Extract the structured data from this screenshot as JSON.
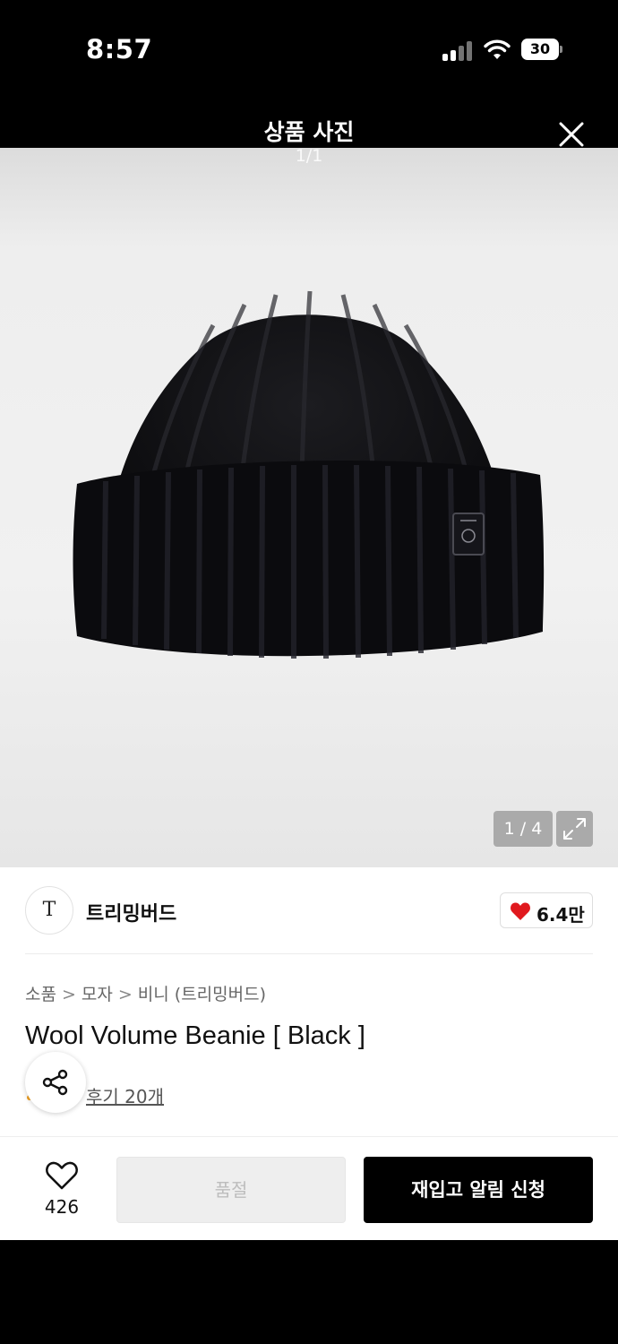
{
  "status_bar": {
    "time": "8:57",
    "battery_level": "30",
    "icons": [
      "cellular-signal-icon",
      "wifi-icon",
      "battery-icon"
    ]
  },
  "viewer": {
    "title": "상품 사진",
    "photo_counter": "1/1",
    "close_icon": "close-icon"
  },
  "gallery": {
    "image_counter": "1 / 4",
    "expand_icon": "expand-icon"
  },
  "brand": {
    "logo_text": "T",
    "name": "트리밍버드",
    "like_count": "6.4만",
    "like_color": "#e0191e"
  },
  "product": {
    "breadcrumb": [
      "소품",
      "모자",
      "비니 (트리밍버드)"
    ],
    "breadcrumb_separator": ">",
    "title": "Wool Volume Beanie [ Black ]",
    "review_link": "후기 20개"
  },
  "action_bar": {
    "wish_count": "426",
    "soldout_label": "품절",
    "restock_label": "재입고 알림 신청"
  },
  "colors": {
    "header_bg": "#000000",
    "primary_button": "#000000",
    "disabled_button": "#eeeeee"
  }
}
